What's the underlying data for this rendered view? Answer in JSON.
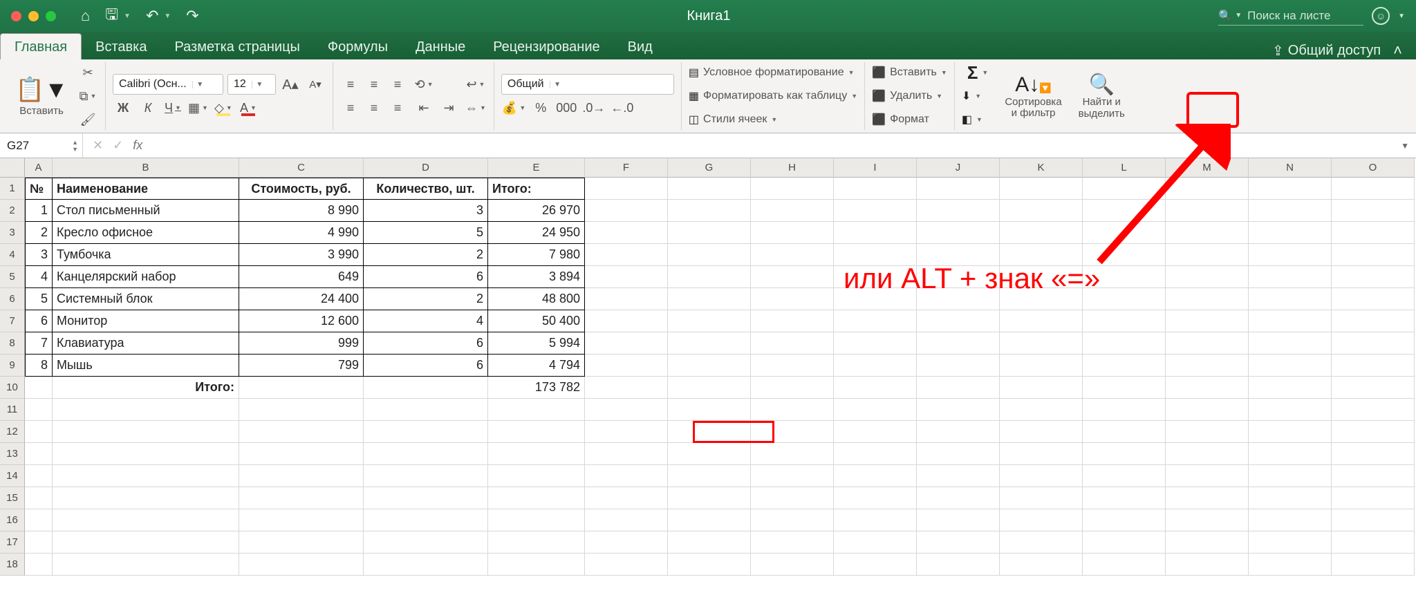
{
  "title": "Книга1",
  "search_placeholder": "Поиск на листе",
  "tabs": {
    "home": "Главная",
    "insert": "Вставка",
    "layout": "Разметка страницы",
    "formulas": "Формулы",
    "data": "Данные",
    "review": "Рецензирование",
    "view": "Вид"
  },
  "share": "Общий доступ",
  "ribbon": {
    "paste": "Вставить",
    "font_name": "Calibri (Осн...",
    "font_size": "12",
    "number_format": "Общий",
    "cond_fmt": "Условное форматирование",
    "as_table": "Форматировать как таблицу",
    "cell_styles": "Стили ячеек",
    "insert": "Вставить",
    "delete": "Удалить",
    "format": "Формат",
    "sort_filter_l1": "Сортировка",
    "sort_filter_l2": "и фильтр",
    "find_l1": "Найти и",
    "find_l2": "выделить"
  },
  "namebox": "G27",
  "cols": [
    "A",
    "B",
    "C",
    "D",
    "E",
    "F",
    "G",
    "H",
    "I",
    "J",
    "K",
    "L",
    "M",
    "N",
    "O"
  ],
  "headers": {
    "a": "№",
    "b": "Наименование",
    "c": "Стоимость, руб.",
    "d": "Количество, шт.",
    "e": "Итого:"
  },
  "rows": [
    {
      "n": "1",
      "name": "Стол письменный",
      "price": "8 990",
      "qty": "3",
      "total": "26 970"
    },
    {
      "n": "2",
      "name": "Кресло офисное",
      "price": "4 990",
      "qty": "5",
      "total": "24 950"
    },
    {
      "n": "3",
      "name": "Тумбочка",
      "price": "3 990",
      "qty": "2",
      "total": "7 980"
    },
    {
      "n": "4",
      "name": "Канцелярский набор",
      "price": "649",
      "qty": "6",
      "total": "3 894"
    },
    {
      "n": "5",
      "name": "Системный блок",
      "price": "24 400",
      "qty": "2",
      "total": "48 800"
    },
    {
      "n": "6",
      "name": "Монитор",
      "price": "12 600",
      "qty": "4",
      "total": "50 400"
    },
    {
      "n": "7",
      "name": "Клавиатура",
      "price": "999",
      "qty": "6",
      "total": "5 994"
    },
    {
      "n": "8",
      "name": "Мышь",
      "price": "799",
      "qty": "6",
      "total": "4 794"
    }
  ],
  "footer": {
    "label": "Итого:",
    "total": "173 782"
  },
  "annotation": "или  ALT  +  знак  «=»"
}
